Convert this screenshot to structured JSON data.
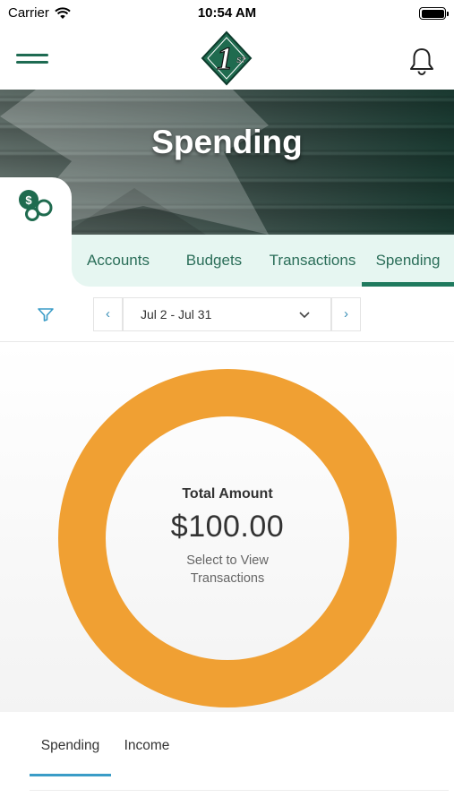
{
  "status_bar": {
    "carrier": "Carrier",
    "time": "10:54 AM"
  },
  "header": {
    "logo_text": "1ST",
    "icons": [
      "menu-icon",
      "bell-icon"
    ]
  },
  "hero": {
    "title": "Spending"
  },
  "tabs": [
    {
      "label": "Accounts",
      "active": false
    },
    {
      "label": "Budgets",
      "active": false
    },
    {
      "label": "Transactions",
      "active": false
    },
    {
      "label": "Spending",
      "active": true
    }
  ],
  "filter": {
    "date_range": "Jul 2 - Jul 31",
    "prev_glyph": "‹",
    "next_glyph": "›"
  },
  "summary": {
    "total_label": "Total Amount",
    "total_value": "$100.00",
    "hint": "Select to View Transactions"
  },
  "chart_data": {
    "type": "pie",
    "categories": [
      ""
    ],
    "values": [
      100.0
    ]
  },
  "bottom_tabs": [
    {
      "label": "Spending",
      "active": true
    },
    {
      "label": "Income",
      "active": false
    }
  ],
  "colors": {
    "brand_green": "#1f7a5e",
    "tab_bg": "#e6f6f1",
    "donut_orange": "#f0a033",
    "link_blue": "#3a9cc7"
  }
}
